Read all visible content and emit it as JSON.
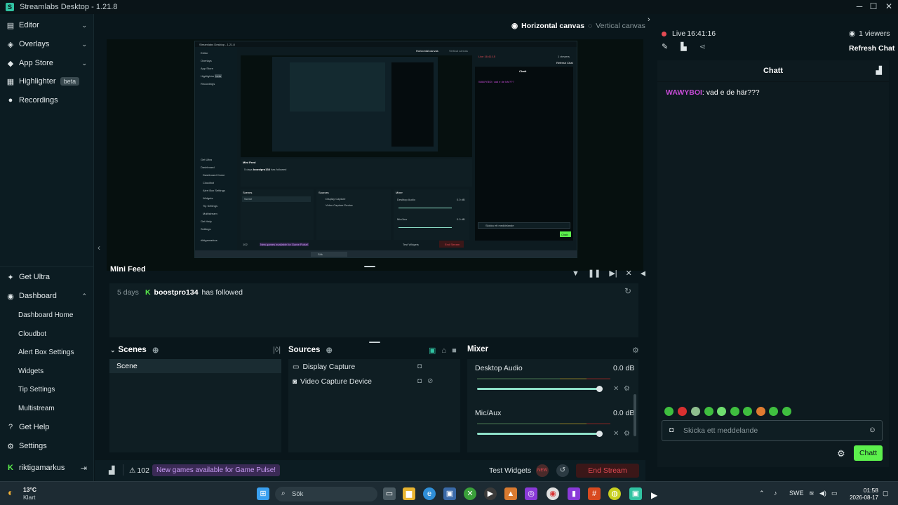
{
  "window": {
    "title": "Streamlabs Desktop - 1.21.8"
  },
  "sidebar": {
    "items": [
      {
        "label": "Editor",
        "icon": "editor-icon"
      },
      {
        "label": "Overlays",
        "icon": "overlays-icon"
      },
      {
        "label": "App Store",
        "icon": "app-store-icon"
      },
      {
        "label": "Highlighter",
        "icon": "highlighter-icon",
        "badge": "beta"
      },
      {
        "label": "Recordings",
        "icon": "recordings-icon"
      }
    ],
    "bottom": {
      "get_ultra": "Get Ultra",
      "dashboard": "Dashboard",
      "dashboard_items": [
        "Dashboard Home",
        "Cloudbot",
        "Alert Box Settings",
        "Widgets",
        "Tip Settings",
        "Multistream"
      ],
      "get_help": "Get Help",
      "settings": "Settings",
      "user": "riktigamarkus"
    }
  },
  "canvas": {
    "horizontal": "Horizontal canvas",
    "vertical": "Vertical canvas"
  },
  "preview_shot": {
    "title": "Streamlabs Desktop - 1.21.8",
    "sidebar": [
      "Editor",
      "Overlays",
      "App Store",
      "Highlighter",
      "Recordings"
    ],
    "highlighter_badge": "beta",
    "bottom_items": [
      "Get Ultra",
      "Dashboard",
      "Dashboard Home",
      "Cloudbot",
      "Alert Box Settings",
      "Widgets",
      "Tip Settings",
      "Multistream",
      "Get Help",
      "Settings"
    ],
    "user": "riktigamarkus",
    "canvas_h": "Horizontal canvas",
    "canvas_v": "Vertical canvas",
    "live": "Live 16:41:15",
    "viewers": "1 viewers",
    "refresh": "Refresh Chat",
    "chat_title": "Chatt",
    "chat_msg": "WAWYBOI: vad e de här???",
    "chat_placeholder": "Skicka ett meddelande",
    "chat_button": "Chatt",
    "mini_feed": "Mini Feed",
    "feed_age": "5 days",
    "feed_user": "boostpro134",
    "feed_action": "has followed",
    "scenes": "Scenes",
    "scene": "Scene",
    "sources": "Sources",
    "sources_list": [
      "Display Capture",
      "Video Capture Device"
    ],
    "mixer": "Mixer",
    "desktop_audio": "Desktop Audio",
    "desktop_db": "0.0 dB",
    "mic": "Mic/Aux",
    "mic_db": "0.0 dB",
    "game_pulse": "New games available for Game Pulse!",
    "alerts": "102",
    "test_widgets": "Test Widgets",
    "end_stream": "End Stream",
    "search": "Sök"
  },
  "mini_feed": {
    "title": "Mini Feed",
    "items": [
      {
        "age": "5 days",
        "user": "boostpro134",
        "action": "has followed"
      }
    ]
  },
  "scenes": {
    "title": "Scenes",
    "items": [
      "Scene"
    ]
  },
  "sources": {
    "title": "Sources",
    "items": [
      "Display Capture",
      "Video Capture Device"
    ]
  },
  "mixer": {
    "title": "Mixer",
    "channels": [
      {
        "name": "Desktop Audio",
        "db": "0.0 dB",
        "volume": 1.0
      },
      {
        "name": "Mic/Aux",
        "db": "0.0 dB",
        "volume": 1.0
      }
    ]
  },
  "footer": {
    "alerts": "102",
    "game_pulse": "New games available for Game Pulse!",
    "test_widgets": "Test Widgets",
    "test_badge": "NEW",
    "end_stream": "End Stream"
  },
  "live": {
    "status": "Live",
    "time": "16:41:16",
    "viewers": "1 viewers",
    "refresh": "Refresh Chat"
  },
  "chat": {
    "title": "Chatt",
    "messages": [
      {
        "user": "WAWYBOI",
        "text": ": vad e de här???"
      }
    ],
    "placeholder": "Skicka ett meddelande",
    "send": "Chatt"
  },
  "taskbar": {
    "temp": "13°C",
    "weather": "Klart",
    "search": "Sök",
    "lang": "SWE",
    "time": "01:58",
    "date": "2026-08-17"
  },
  "colors": {
    "accent": "#31c3a2",
    "live": "#e64b54",
    "chat_user": "#c84cd8",
    "chat_button": "#5cf04c",
    "game_pulse": "#c89cf5"
  }
}
